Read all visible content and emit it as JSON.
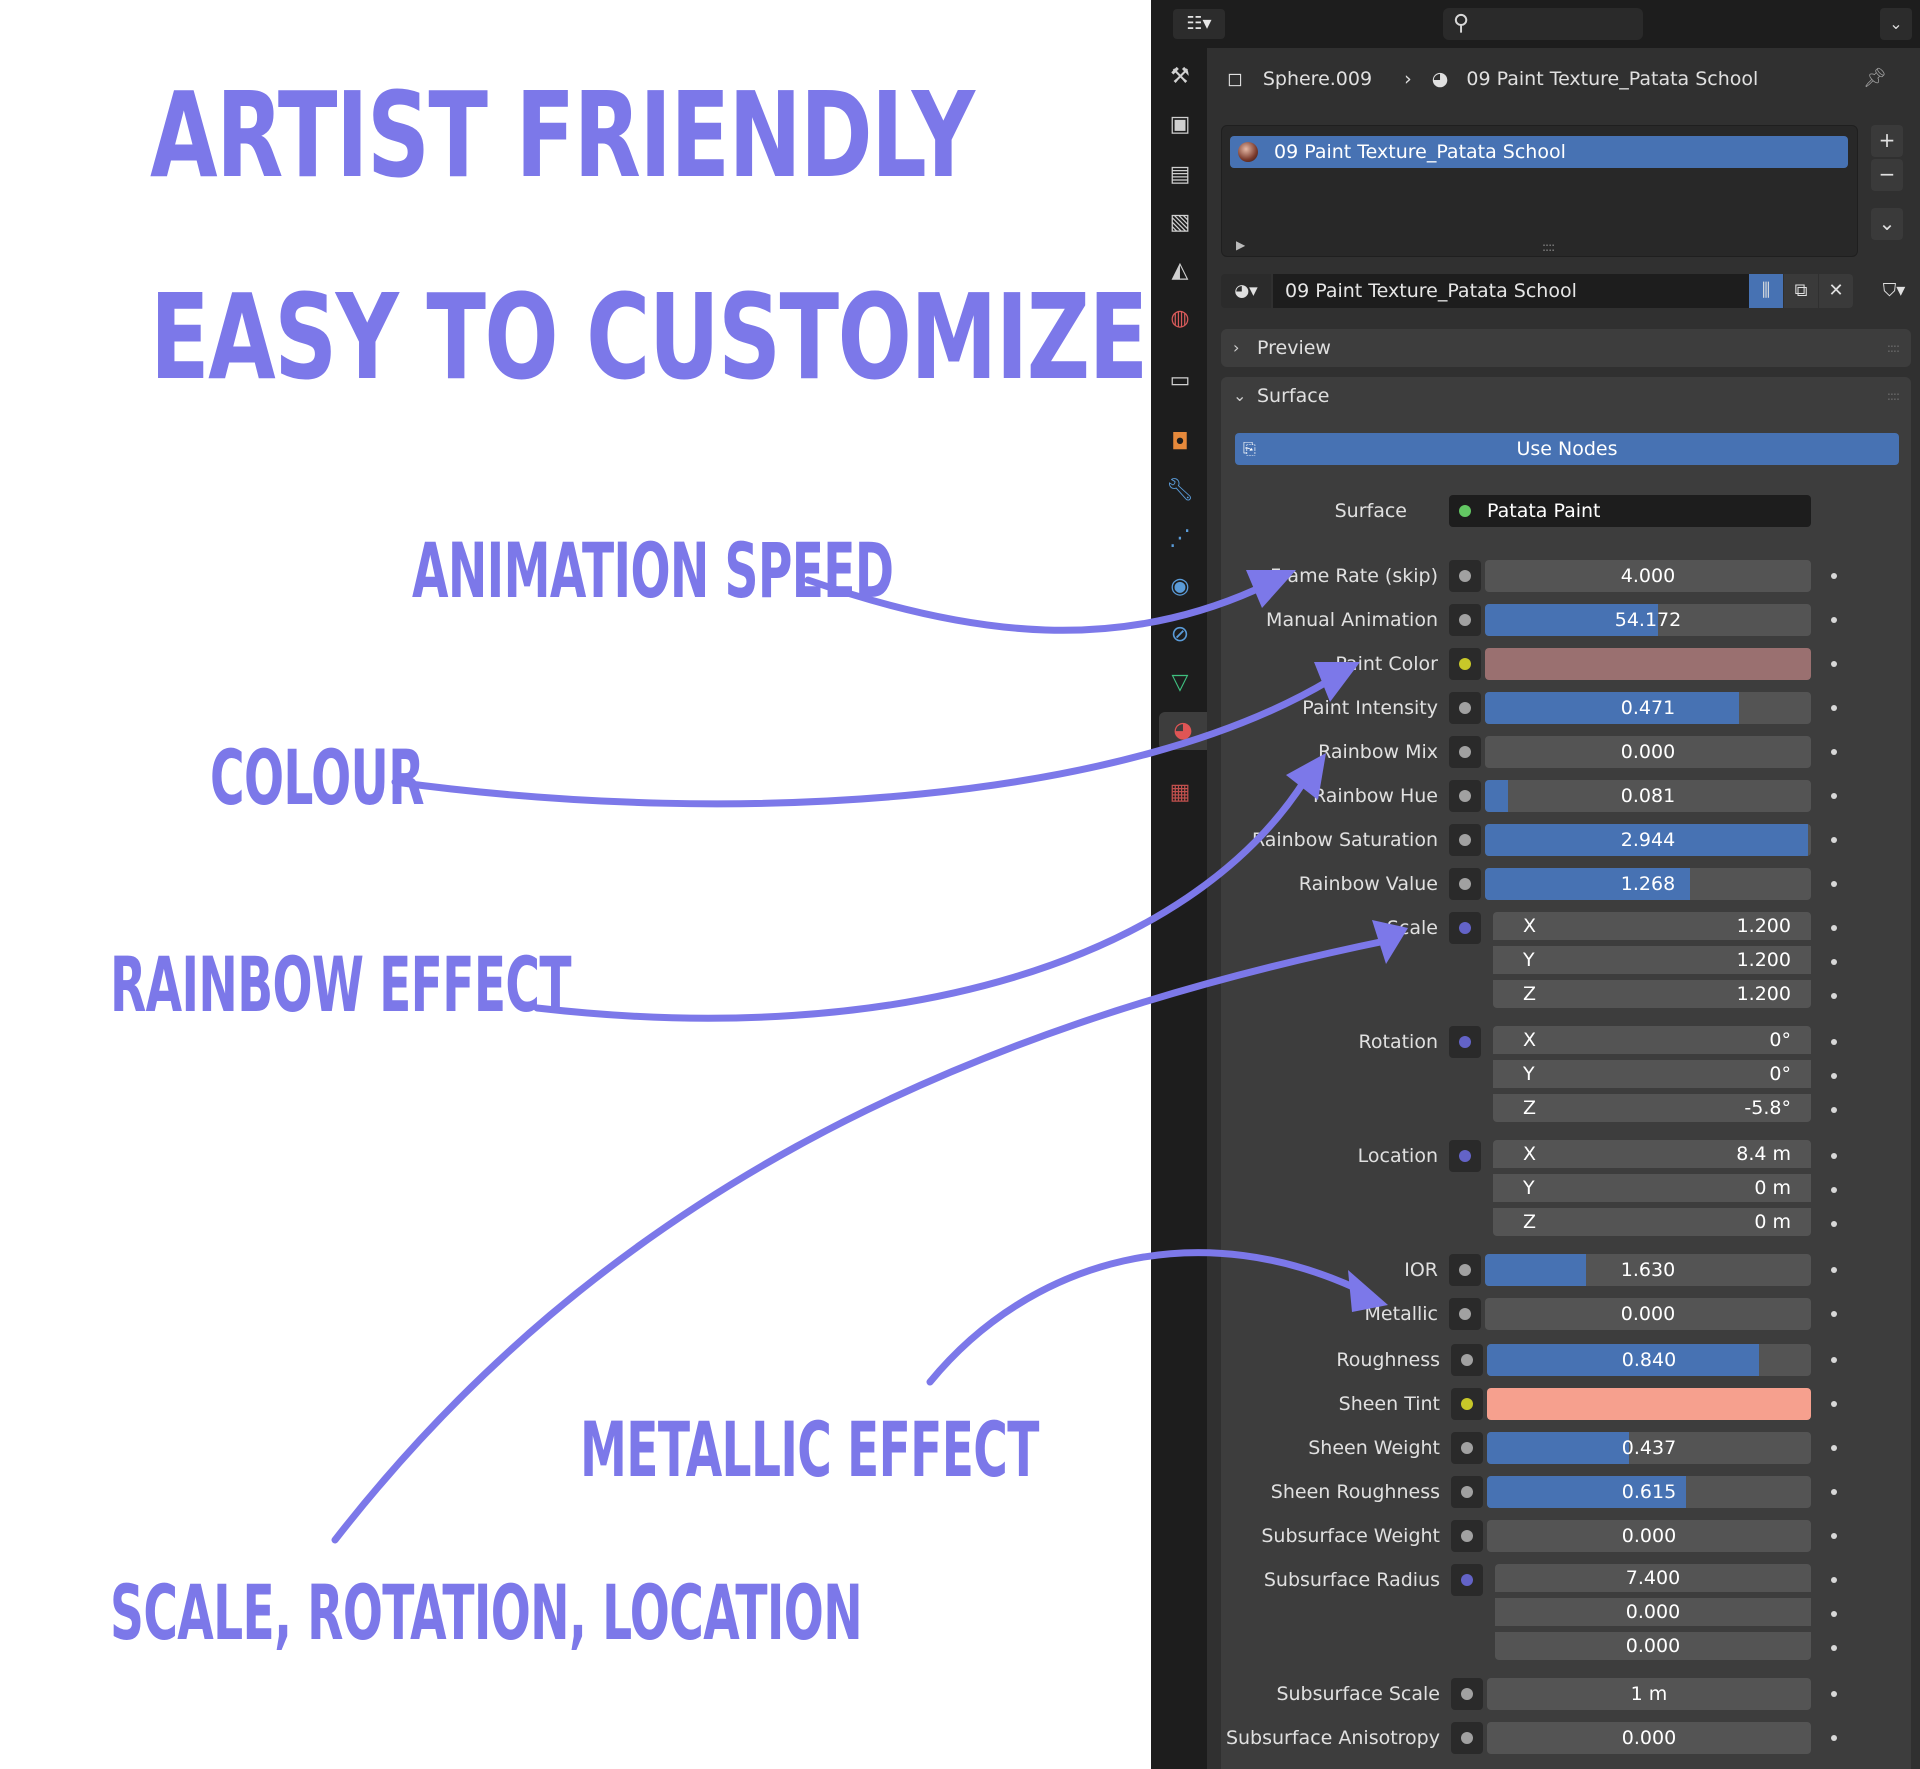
{
  "headline": {
    "line1": "Artist Friendly",
    "line2": "Easy to Customize"
  },
  "annotations": {
    "animation_speed": "Animation Speed",
    "colour": "Colour",
    "rainbow_effect": "Rainbow Effect",
    "metallic_effect": "Metallic Effect",
    "scale_rotation_location": "Scale, Rotation, Location"
  },
  "colors": {
    "annotation": "#7c78e9",
    "panel_bg": "#303030",
    "accent": "#4772b3",
    "paint_color": "#9a7070",
    "sheen_tint": "#f6a08e"
  },
  "panel": {
    "editor_type_icon": "properties-icon",
    "search_icon": "search-icon",
    "object_name": "Sphere.009",
    "material_name": "09 Paint Texture_Patata School",
    "slot_item": "09 Paint Texture_Patata School",
    "material_field": "09 Paint Texture_Patata School",
    "preview_label": "Preview",
    "surface_section_label": "Surface",
    "use_nodes_label": "Use Nodes",
    "surface_label": "Surface",
    "surface_shader": "Patata Paint"
  },
  "properties": {
    "frame_rate": {
      "label": "Frame Rate (skip)",
      "value": "4.000"
    },
    "manual_animation": {
      "label": "Manual Animation",
      "value": "54.172",
      "fill": 0.53
    },
    "paint_color": {
      "label": "Paint Color"
    },
    "paint_intensity": {
      "label": "Paint Intensity",
      "value": "0.471",
      "fill": 0.78
    },
    "rainbow_mix": {
      "label": "Rainbow Mix",
      "value": "0.000"
    },
    "rainbow_hue": {
      "label": "Rainbow Hue",
      "value": "0.081",
      "fill": 0.07
    },
    "rainbow_saturation": {
      "label": "Rainbow Saturation",
      "value": "2.944",
      "fill": 0.99
    },
    "rainbow_value": {
      "label": "Rainbow Value",
      "value": "1.268",
      "fill": 0.63
    },
    "scale": {
      "label": "Scale",
      "x": "1.200",
      "y": "1.200",
      "z": "1.200"
    },
    "rotation": {
      "label": "Rotation",
      "x": "0°",
      "y": "0°",
      "z": "-5.8°"
    },
    "location": {
      "label": "Location",
      "x": "8.4 m",
      "y": "0 m",
      "z": "0 m"
    },
    "ior": {
      "label": "IOR",
      "value": "1.630",
      "fill": 0.31
    },
    "metallic": {
      "label": "Metallic",
      "value": "0.000"
    },
    "roughness": {
      "label": "Roughness",
      "value": "0.840",
      "fill": 0.84
    },
    "sheen_tint": {
      "label": "Sheen Tint"
    },
    "sheen_weight": {
      "label": "Sheen Weight",
      "value": "0.437",
      "fill": 0.437
    },
    "sheen_roughness": {
      "label": "Sheen Roughness",
      "value": "0.615",
      "fill": 0.615
    },
    "subsurface_weight": {
      "label": "Subsurface Weight",
      "value": "0.000"
    },
    "subsurface_radius": {
      "label": "Subsurface Radius",
      "r": "7.400",
      "g": "0.000",
      "b": "0.000"
    },
    "subsurface_scale": {
      "label": "Subsurface Scale",
      "value": "1 m"
    },
    "subsurface_anisotropy": {
      "label": "Subsurface Anisotropy",
      "value": "0.000"
    }
  },
  "axis_labels": {
    "x": "X",
    "y": "Y",
    "z": "Z"
  }
}
